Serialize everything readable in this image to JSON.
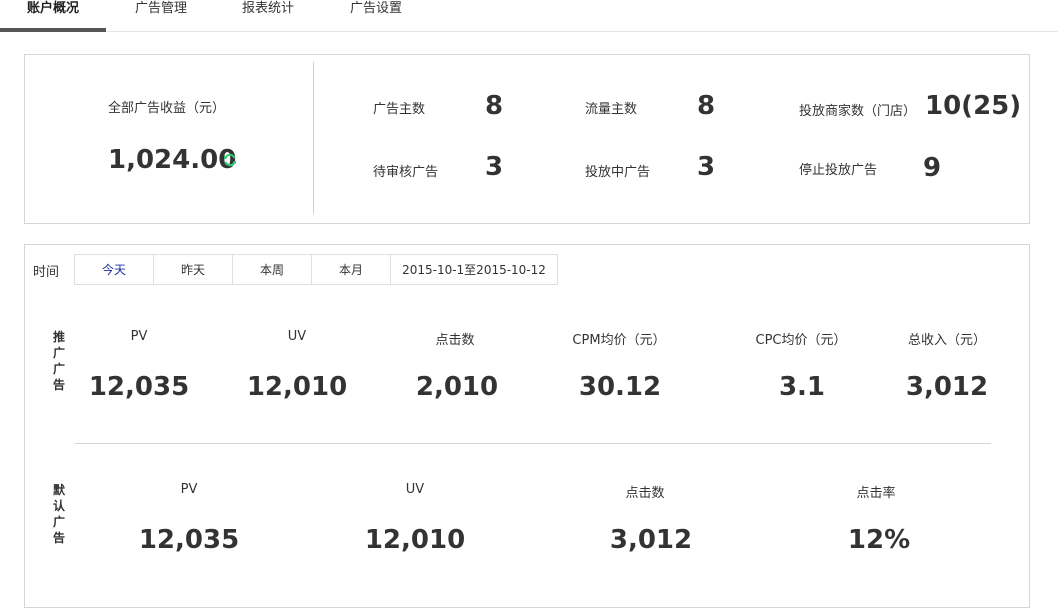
{
  "tabs": [
    "账户概况",
    "广告管理",
    "报表统计",
    "广告设置"
  ],
  "summary": {
    "total_label": "全部广告收益（元）",
    "total_value": "1,024.00",
    "stats": [
      {
        "label": "广告主数",
        "value": "8"
      },
      {
        "label": "流量主数",
        "value": "8"
      },
      {
        "label": "投放商家数（门店）",
        "value": "10(25)"
      },
      {
        "label": "待审核广告",
        "value": "3"
      },
      {
        "label": "投放中广告",
        "value": "3"
      },
      {
        "label": "停止投放广告",
        "value": "9"
      }
    ]
  },
  "detail": {
    "time_label": "时间",
    "filters": [
      "今天",
      "昨天",
      "本周",
      "本月",
      "2015-10-1至2015-10-12"
    ],
    "active_filter": "今天",
    "promoted": {
      "side_label": "推广广告",
      "metrics": [
        {
          "label": "PV",
          "value": "12,035"
        },
        {
          "label": "UV",
          "value": "12,010"
        },
        {
          "label": "点击数",
          "value": "2,010"
        },
        {
          "label": "CPM均价（元）",
          "value": "30.12"
        },
        {
          "label": "CPC均价（元）",
          "value": "3.1"
        },
        {
          "label": "总收入（元）",
          "value": "3,012"
        }
      ]
    },
    "default": {
      "side_label": "默认广告",
      "metrics": [
        {
          "label": "PV",
          "value": "12,035"
        },
        {
          "label": "UV",
          "value": "12,010"
        },
        {
          "label": "点击数",
          "value": "3,012"
        },
        {
          "label": "点击率",
          "value": "12%"
        }
      ]
    }
  },
  "colors": {
    "active_tab_underline": "#555555",
    "refresh_icon": "#2ecc71",
    "active_filter_text": "#1a2fa0"
  },
  "icons": {
    "refresh": "refresh-icon"
  }
}
